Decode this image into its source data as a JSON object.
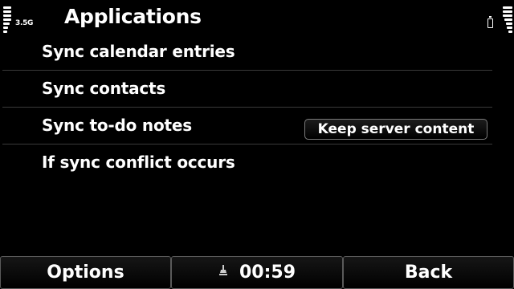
{
  "header": {
    "title": "Applications",
    "network": "3.5G",
    "signal_level": 0.7,
    "battery_level": 0.1
  },
  "settings": [
    {
      "label": "Sync calendar entries",
      "value": ""
    },
    {
      "label": "Sync contacts",
      "value": ""
    },
    {
      "label": "Sync to-do notes",
      "value": ""
    },
    {
      "label": "If sync conflict occurs",
      "value": "Keep server content"
    }
  ],
  "softkeys": {
    "left": "Options",
    "middle": "00:59",
    "right": "Back",
    "middle_icon": "connection-timer-icon"
  },
  "colors": {
    "background": "#000000",
    "text": "#ffffff",
    "divider": "#3a3a3a"
  }
}
